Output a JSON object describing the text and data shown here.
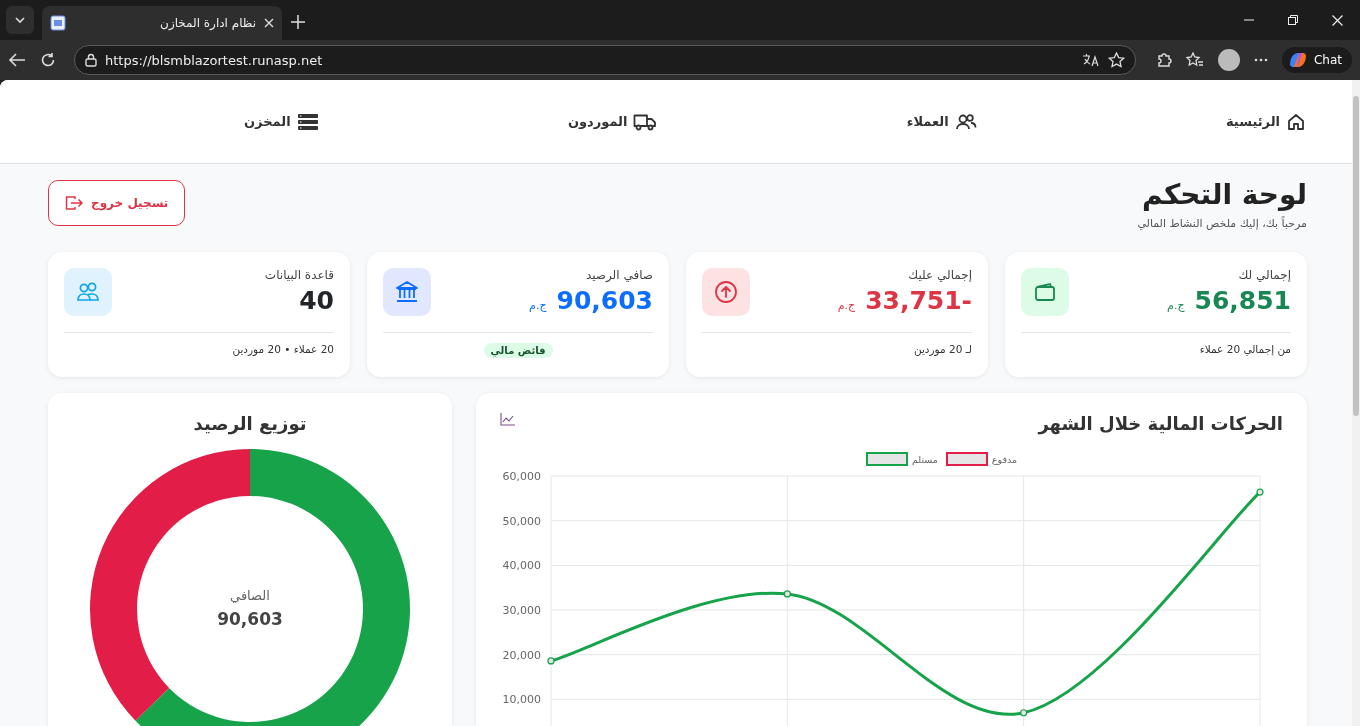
{
  "browser": {
    "tab_title": "نظام ادارة المخازن",
    "url": "https://blsmblazortest.runasp.net",
    "chat_label": "Chat"
  },
  "nav": [
    {
      "label": "الرئيسية",
      "kind": "home"
    },
    {
      "label": "العملاء",
      "kind": "users"
    },
    {
      "label": "الموردون",
      "kind": "truck"
    },
    {
      "label": "المخزن",
      "kind": "list"
    }
  ],
  "header": {
    "title": "لوحة التحكم",
    "subtitle": "مرحباً بك، إليك ملخص النشاط المالي",
    "logout_button": "تسجيل خروج"
  },
  "cards": [
    {
      "kind": "wallet",
      "label": "إجمالي لك",
      "value": "56,851",
      "currency": "ج.م",
      "color": "#198754",
      "footer": "من إجمالي 20 عملاء"
    },
    {
      "kind": "arrow",
      "label": "إجمالي عليك",
      "value": "-33,751",
      "currency": "ج.م",
      "color": "#dc3545",
      "footer": "لـ 20 موردين"
    },
    {
      "kind": "bank",
      "label": "صافي الرصيد",
      "value": "90,603",
      "currency": "ج.م",
      "color": "#0d6efd",
      "badge": "فائض مالي"
    },
    {
      "kind": "users",
      "label": "قاعدة البيانات",
      "value": "40",
      "color": "#212529",
      "footer": "20 عملاء • 20 موردين"
    }
  ],
  "line_card": {
    "title": "الحركات المالية خلال الشهر",
    "chart_data": {
      "type": "line",
      "grid": true,
      "ylim": [
        0,
        60000
      ],
      "yticks": [
        {
          "value": 10000,
          "label": "10,000"
        },
        {
          "value": 20000,
          "label": "20,000"
        },
        {
          "value": 30000,
          "label": "30,000"
        },
        {
          "value": 40000,
          "label": "40,000"
        },
        {
          "value": 50000,
          "label": "50,000"
        },
        {
          "value": 60000,
          "label": "60,000"
        }
      ],
      "series": [
        {
          "name": "مدفوع",
          "color": "#e11d48",
          "values": [
            null,
            null,
            null,
            null
          ]
        },
        {
          "name": "مستلم",
          "color": "#16a34a",
          "marker": true,
          "values": [
            18600,
            33600,
            7000,
            56400
          ]
        }
      ]
    }
  },
  "donut_card": {
    "title": "توزيع الرصيد",
    "center_label": "الصافي",
    "center_value": "90,603",
    "chart_data": {
      "type": "donut",
      "values": [
        62.7,
        37.3
      ],
      "colors": [
        "#16a34a",
        "#e11d48"
      ]
    }
  }
}
